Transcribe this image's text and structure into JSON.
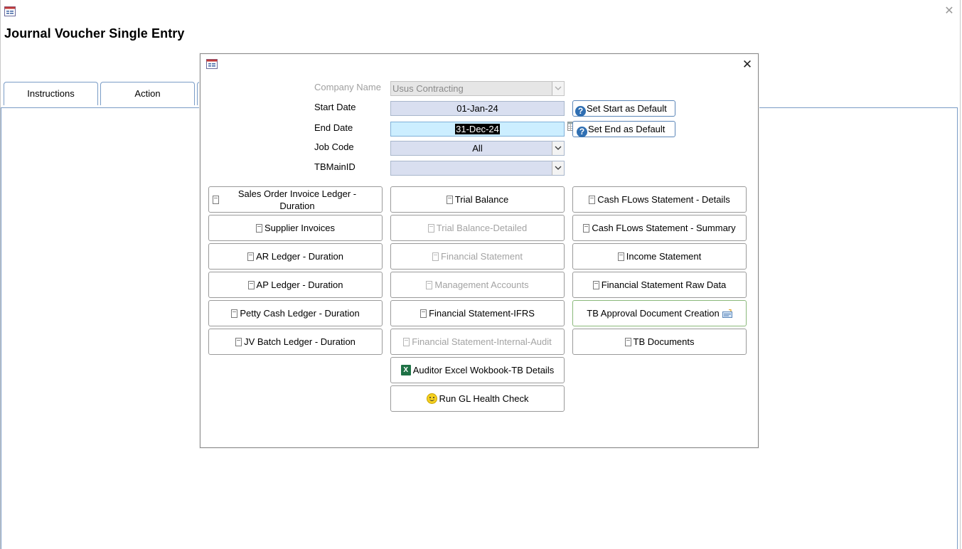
{
  "window": {
    "title": "Journal Voucher Single Entry",
    "tabs": [
      {
        "label": "Instructions"
      },
      {
        "label": "Action"
      }
    ]
  },
  "dialog": {
    "fields": {
      "company_name": {
        "label": "Company Name",
        "value": "Usus Contracting"
      },
      "start_date": {
        "label": "Start Date",
        "value": "01-Jan-24"
      },
      "end_date": {
        "label": "End Date",
        "value": "31-Dec-24"
      },
      "job_code": {
        "label": "Job Code",
        "value": "All"
      },
      "tbmain_id": {
        "label": "TBMainID",
        "value": ""
      }
    },
    "set_start_default": "Set Start as Default",
    "set_end_default": "Set End as Default",
    "buttons": {
      "col1": [
        {
          "label": "Sales Order Invoice Ledger - Duration"
        },
        {
          "label": "Supplier Invoices"
        },
        {
          "label": "AR Ledger - Duration"
        },
        {
          "label": "AP Ledger - Duration"
        },
        {
          "label": "Petty Cash Ledger - Duration"
        },
        {
          "label": "JV Batch Ledger - Duration"
        }
      ],
      "col2": [
        {
          "label": "Trial Balance"
        },
        {
          "label": "Trial Balance-Detailed"
        },
        {
          "label": "Financial Statement"
        },
        {
          "label": "Management Accounts"
        },
        {
          "label": "Financial Statement-IFRS"
        },
        {
          "label": "Financial Statement-Internal-Audit"
        },
        {
          "label": "Auditor Excel Wokbook-TB Details"
        },
        {
          "label": "Run GL Health Check"
        }
      ],
      "col3": [
        {
          "label": "Cash FLows Statement - Details"
        },
        {
          "label": "Cash FLows Statement - Summary"
        },
        {
          "label": "Income Statement"
        },
        {
          "label": "Financial Statement Raw Data"
        },
        {
          "label": "TB Approval Document Creation"
        },
        {
          "label": "TB Documents"
        }
      ]
    }
  }
}
